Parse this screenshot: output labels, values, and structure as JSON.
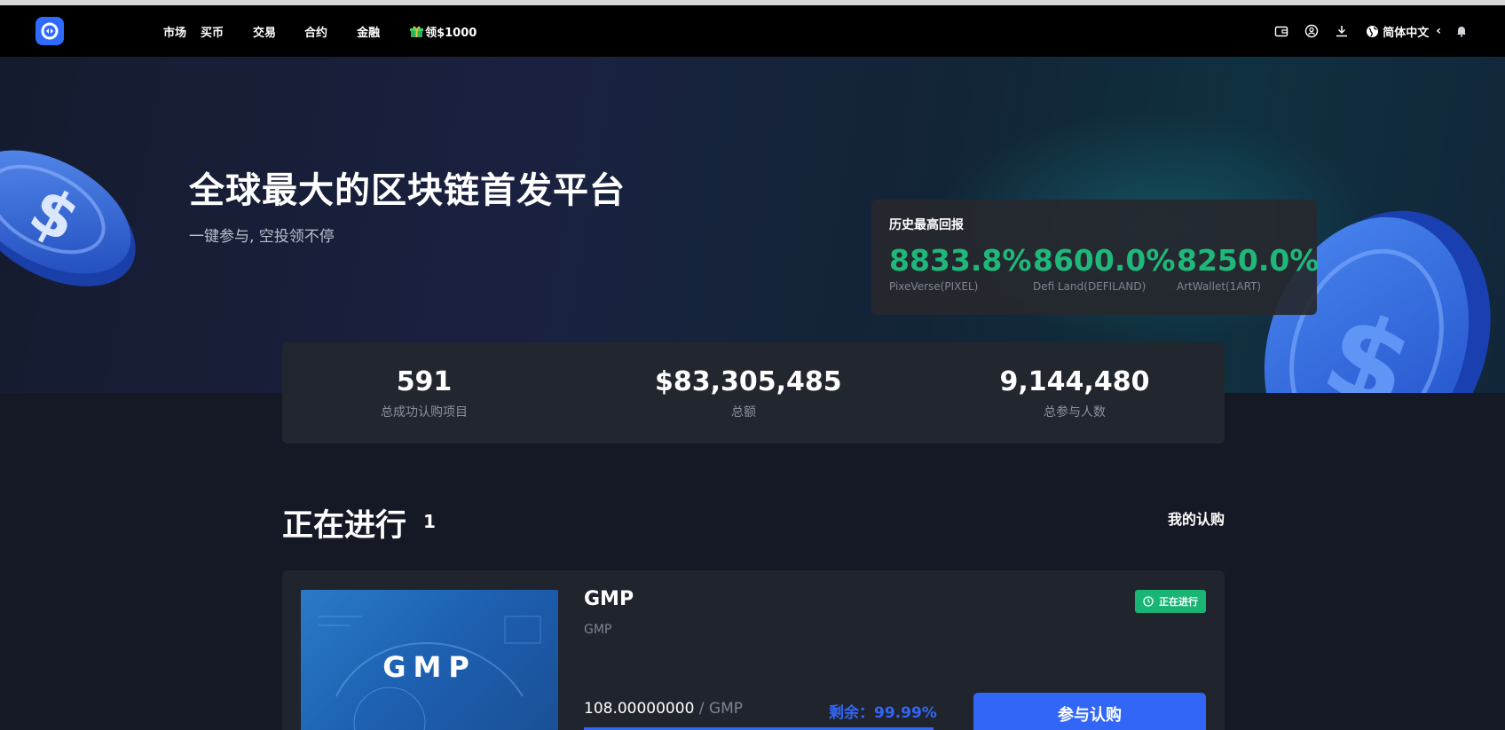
{
  "nav": {
    "items": [
      "市场",
      "买币",
      "交易",
      "合约",
      "金融"
    ],
    "promo_label": "领$1000",
    "language": "简体中文"
  },
  "hero": {
    "title": "全球最大的区块链首发平台",
    "subtitle": "一键参与, 空投领不停",
    "returns": {
      "title": "历史最高回报",
      "items": [
        {
          "pct": "8833.8%",
          "name": "PixeVerse(PIXEL)"
        },
        {
          "pct": "8600.0%",
          "name": "Defi Land(DEFILAND)"
        },
        {
          "pct": "8250.0%",
          "name": "ArtWallet(1ART)"
        }
      ]
    }
  },
  "stats": [
    {
      "value": "591",
      "label": "总成功认购项目"
    },
    {
      "value": "$83,305,485",
      "label": "总额"
    },
    {
      "value": "9,144,480",
      "label": "总参与人数"
    }
  ],
  "ongoing": {
    "title": "正在进行",
    "count": "1",
    "my_subscriptions": "我的认购"
  },
  "project": {
    "image_text": "GMP",
    "name": "GMP",
    "symbol": "GMP",
    "status": "正在进行",
    "price": "108.00000000",
    "price_unit": " / GMP",
    "remaining": "剩余：99.99%",
    "remaining_fraction": 0.9999,
    "join_label": "参与认购"
  },
  "colors": {
    "accent": "#3266f6",
    "green": "#1fb87a",
    "nav_bg": "#000000"
  }
}
